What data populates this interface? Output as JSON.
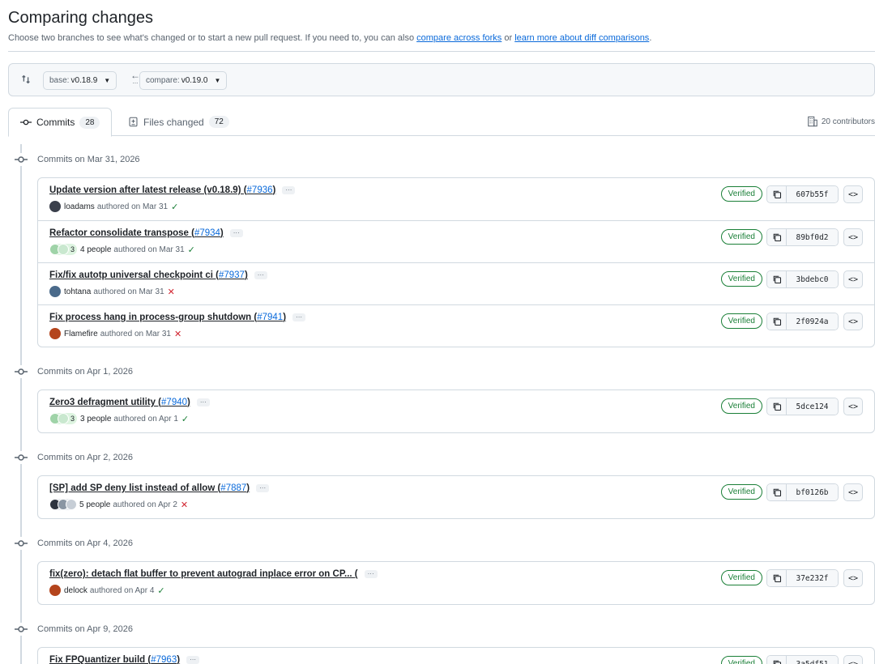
{
  "header": {
    "title": "Comparing changes",
    "subtitle_prefix": "Choose two branches to see what's changed or to start a new pull request. If you need to, you can also ",
    "link_forks": "compare across forks",
    "subtitle_mid": " or ",
    "link_learn": "learn more about diff comparisons",
    "subtitle_suffix": "."
  },
  "compare": {
    "base_label": "base:",
    "base_value": "v0.18.9",
    "compare_label": "compare:",
    "compare_value": "v0.19.0",
    "arrow": "←",
    "arrow_dots": "..."
  },
  "tabs": {
    "commits_label": "Commits",
    "commits_count": "28",
    "files_label": "Files changed",
    "files_count": "72",
    "contributors": "20 contributors"
  },
  "groups": [
    {
      "date": "Commits on Mar 31, 2026",
      "commits": [
        {
          "title": "Update version after latest release (v0.18.9) (",
          "pr": "#7936",
          "close": ")",
          "author": "loadams",
          "authored": "authored on Mar 31",
          "status": "✓",
          "verified": "Verified",
          "sha": "607b55f"
        },
        {
          "title": "Refactor consolidate transpose (",
          "pr": "#7934",
          "close": ")",
          "group_count": "3",
          "author": "4 people",
          "authored": "authored on Mar 31",
          "status": "✓",
          "verified": "Verified",
          "sha": "89bf0d2"
        },
        {
          "title": "Fix/fix autotp universal checkpoint ci (",
          "pr": "#7937",
          "close": ")",
          "author": "tohtana",
          "authored": "authored on Mar 31",
          "status": "✕",
          "verified": "Verified",
          "sha": "3bdebc0"
        },
        {
          "title": "Fix process hang in process-group shutdown (",
          "pr": "#7941",
          "close": ")",
          "author": "Flamefire",
          "authored": "authored on Mar 31",
          "status": "✕",
          "verified": "Verified",
          "sha": "2f0924a"
        }
      ]
    },
    {
      "date": "Commits on Apr 1, 2026",
      "commits": [
        {
          "title": "Zero3 defragment utility (",
          "pr": "#7940",
          "close": ")",
          "group_count": "3",
          "author": "3 people",
          "authored": "authored on Apr 1",
          "status": "✓",
          "verified": "Verified",
          "sha": "5dce124"
        }
      ]
    },
    {
      "date": "Commits on Apr 2, 2026",
      "commits": [
        {
          "title": "[SP] add SP deny list instead of allow (",
          "pr": "#7887",
          "close": ")",
          "author": "5 people",
          "authored": "authored on Apr 2",
          "status": "✕",
          "verified": "Verified",
          "sha": "bf0126b"
        }
      ]
    },
    {
      "date": "Commits on Apr 4, 2026",
      "commits": [
        {
          "title": "fix(zero): detach flat buffer to prevent autograd inplace error on CP... (",
          "pr": "",
          "close": "",
          "author": "delock",
          "authored": "authored on Apr 4",
          "status": "✓",
          "verified": "Verified",
          "sha": "37e232f"
        }
      ]
    },
    {
      "date": "Commits on Apr 9, 2026",
      "commits": [
        {
          "title": "Fix FPQuantizer build (",
          "pr": "#7963",
          "close": ")",
          "author": "",
          "authored": "",
          "status": "",
          "verified": "Verified",
          "sha": "3a5df51"
        }
      ]
    }
  ],
  "ui": {
    "ellipsis": "···",
    "browse": "<>"
  },
  "colors": {
    "accent": "#0969da",
    "success": "#1a7f37",
    "danger": "#d1242f",
    "border": "#d1d9e0",
    "muted": "#59636e"
  }
}
